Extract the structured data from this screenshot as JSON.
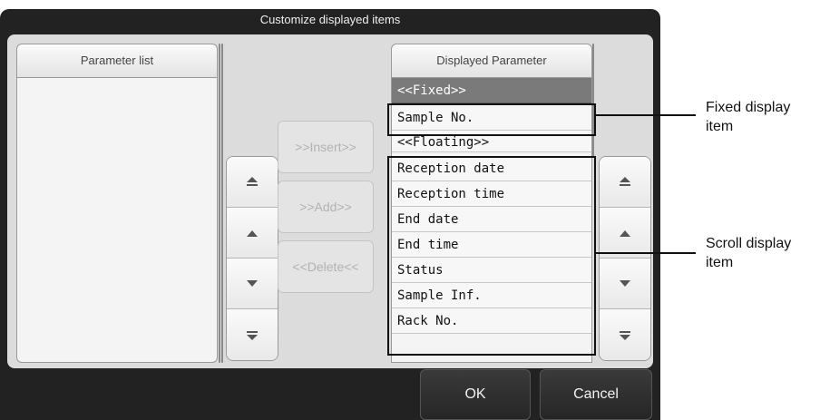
{
  "dialog": {
    "title": "Customize displayed items",
    "ok_label": "OK",
    "cancel_label": "Cancel"
  },
  "parameter_list": {
    "header": "Parameter list"
  },
  "displayed": {
    "header": "Displayed Parameter",
    "fixed_section": "<<Fixed>>",
    "fixed_items": [
      "Sample No."
    ],
    "floating_section": "<<Floating>>",
    "floating_items": [
      "Reception date",
      "Reception time",
      "End date",
      "End time",
      "Status",
      "Sample Inf.",
      "Rack No."
    ]
  },
  "actions": {
    "insert_label": ">>Insert>>",
    "add_label": ">>Add>>",
    "delete_label": "<<Delete<<"
  },
  "scroll_icons": [
    "scroll-top-icon",
    "scroll-up-icon",
    "scroll-down-icon",
    "scroll-bottom-icon"
  ],
  "callouts": {
    "fixed": "Fixed display item",
    "scroll": "Scroll display item"
  },
  "colors": {
    "dialog_bg": "#222222",
    "content_bg": "#dcdcdc",
    "section_header_bg": "#7a7a7a",
    "disabled_text": "#b2b2b2"
  }
}
